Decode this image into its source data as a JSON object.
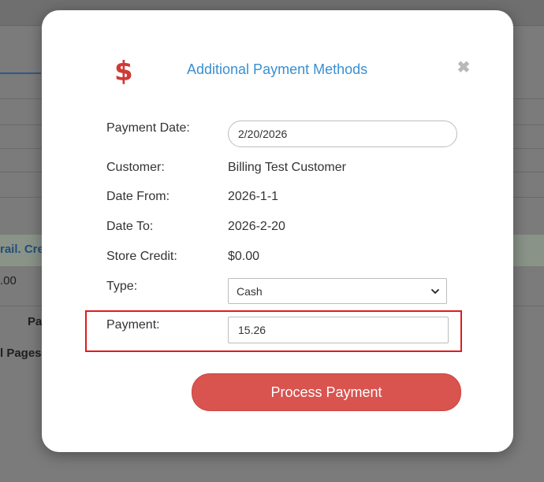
{
  "background": {
    "fragments": [
      "rail. Cre",
      ".00",
      "Pa",
      "l Pages"
    ]
  },
  "modal": {
    "title": "Additional Payment Methods",
    "icon": "dollar-icon",
    "icon_glyph": "$",
    "close_glyph": "✖",
    "fields": {
      "payment_date": {
        "label": "Payment Date:",
        "value": "2/20/2026"
      },
      "customer": {
        "label": "Customer:",
        "value": "Billing Test Customer"
      },
      "date_from": {
        "label": "Date From:",
        "value": "2026-1-1"
      },
      "date_to": {
        "label": "Date To:",
        "value": "2026-2-20"
      },
      "store_credit": {
        "label": "Store Credit:",
        "value": "$0.00"
      },
      "type": {
        "label": "Type:",
        "selected": "Cash"
      },
      "payment": {
        "label": "Payment:",
        "value": "15.26"
      }
    },
    "submit_label": "Process Payment"
  },
  "colors": {
    "accent_title": "#3a8fd0",
    "button": "#d9534f",
    "icon": "#cf3a36",
    "highlight": "#e21b1b"
  }
}
